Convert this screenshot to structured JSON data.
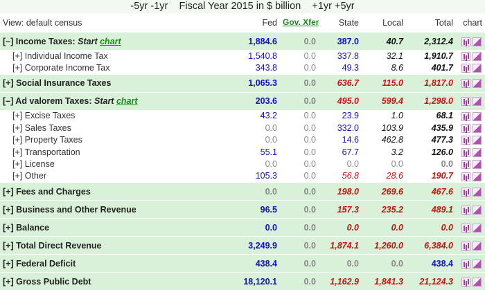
{
  "title": {
    "prev": "-5yr -1yr",
    "heading": "Fiscal Year 2015 in $ billion",
    "next": "+1yr +5yr"
  },
  "header": {
    "view": "View: default census",
    "fed": "Fed",
    "gov": "Gov. Xfer",
    "state": "State",
    "local": "Local",
    "total": "Total",
    "chart": "chart"
  },
  "start_label": "Start",
  "chart_link": "chart",
  "rows": [
    {
      "kind": "sec",
      "label": "[–] Income Taxes:",
      "start": true,
      "fed": "1,884.6",
      "gov": "0.0",
      "state": "387.0",
      "local": "40.7",
      "total": "2,312.4",
      "colors": [
        "blue",
        "gray",
        "blue",
        "it",
        "it"
      ]
    },
    {
      "kind": "sub",
      "label": "[+] Individual Income Tax",
      "fed": "1,540.8",
      "gov": "0.0",
      "state": "337.8",
      "local": "32.1",
      "total": "1,910.7",
      "colors": [
        "blue",
        "gray",
        "blue",
        "it",
        "it"
      ]
    },
    {
      "kind": "sub",
      "label": "[+] Corporate Income Tax",
      "fed": "343.8",
      "gov": "0.0",
      "state": "49.3",
      "local": "8.6",
      "total": "401.7",
      "colors": [
        "blue",
        "gray",
        "blue",
        "it",
        "it"
      ]
    },
    {
      "kind": "sec",
      "label": "[+] Social Insurance Taxes",
      "fed": "1,065.3",
      "gov": "0.0",
      "state": "636.7",
      "local": "115.0",
      "total": "1,817.0",
      "colors": [
        "blue",
        "gray",
        "red",
        "red",
        "red"
      ]
    },
    {
      "kind": "sec",
      "label": "[–] Ad valorem Taxes:",
      "start": true,
      "fed": "203.6",
      "gov": "0.0",
      "state": "495.0",
      "local": "599.4",
      "total": "1,298.0",
      "colors": [
        "blue",
        "gray",
        "red",
        "red",
        "red"
      ]
    },
    {
      "kind": "sub",
      "label": "[+] Excise Taxes",
      "fed": "43.2",
      "gov": "0.0",
      "state": "23.9",
      "local": "1.0",
      "total": "68.1",
      "colors": [
        "blue",
        "gray",
        "blue",
        "it",
        "it"
      ]
    },
    {
      "kind": "sub",
      "label": "[+] Sales Taxes",
      "fed": "0.0",
      "gov": "0.0",
      "state": "332.0",
      "local": "103.9",
      "total": "435.9",
      "colors": [
        "gray",
        "gray",
        "blue",
        "it",
        "it"
      ]
    },
    {
      "kind": "sub",
      "label": "[+] Property Taxes",
      "fed": "0.0",
      "gov": "0.0",
      "state": "14.6",
      "local": "462.8",
      "total": "477.3",
      "colors": [
        "gray",
        "gray",
        "blue",
        "it",
        "it"
      ]
    },
    {
      "kind": "sub",
      "label": "[+] Transportation",
      "fed": "55.1",
      "gov": "0.0",
      "state": "67.7",
      "local": "3.2",
      "total": "126.0",
      "colors": [
        "blue",
        "gray",
        "blue",
        "it",
        "it"
      ]
    },
    {
      "kind": "sub",
      "label": "[+] License",
      "fed": "0.0",
      "gov": "0.0",
      "state": "0.0",
      "local": "0.0",
      "total": "0.0",
      "colors": [
        "gray",
        "gray",
        "gray",
        "gray",
        "gray"
      ]
    },
    {
      "kind": "sub",
      "label": "[+] Other",
      "fed": "105.3",
      "gov": "0.0",
      "state": "56.8",
      "local": "28.6",
      "total": "190.7",
      "colors": [
        "blue",
        "gray",
        "red",
        "red",
        "red"
      ]
    },
    {
      "kind": "sec",
      "label": "[+] Fees and Charges",
      "fed": "0.0",
      "gov": "0.0",
      "state": "198.0",
      "local": "269.6",
      "total": "467.6",
      "colors": [
        "gray",
        "gray",
        "red",
        "red",
        "red"
      ]
    },
    {
      "kind": "sec",
      "label": "[+] Business and Other Revenue",
      "fed": "96.5",
      "gov": "0.0",
      "state": "157.3",
      "local": "235.2",
      "total": "489.1",
      "colors": [
        "blue",
        "gray",
        "red",
        "red",
        "red"
      ]
    },
    {
      "kind": "sec",
      "label": "[+] Balance",
      "fed": "0.0",
      "gov": "0.0",
      "state": "0.0",
      "local": "0.0",
      "total": "0.0",
      "colors": [
        "blue",
        "gray",
        "red",
        "red",
        "red"
      ]
    },
    {
      "kind": "sec",
      "label": "[+] Total Direct Revenue",
      "fed": "3,249.9",
      "gov": "0.0",
      "state": "1,874.1",
      "local": "1,260.0",
      "total": "6,384.0",
      "colors": [
        "blue",
        "gray",
        "red",
        "red",
        "red"
      ]
    },
    {
      "kind": "sec",
      "label": "[+] Federal Deficit",
      "fed": "438.4",
      "gov": "0.0",
      "state": "0.0",
      "local": "0.0",
      "total": "438.4",
      "colors": [
        "blue",
        "gray",
        "gray",
        "gray",
        "blue"
      ]
    },
    {
      "kind": "sec",
      "label": "[+] Gross Public Debt",
      "fed": "18,120.1",
      "gov": "0.0",
      "state": "1,162.9",
      "local": "1,841.3",
      "total": "21,124.3",
      "colors": [
        "blue",
        "gray",
        "red",
        "red",
        "red"
      ]
    }
  ]
}
